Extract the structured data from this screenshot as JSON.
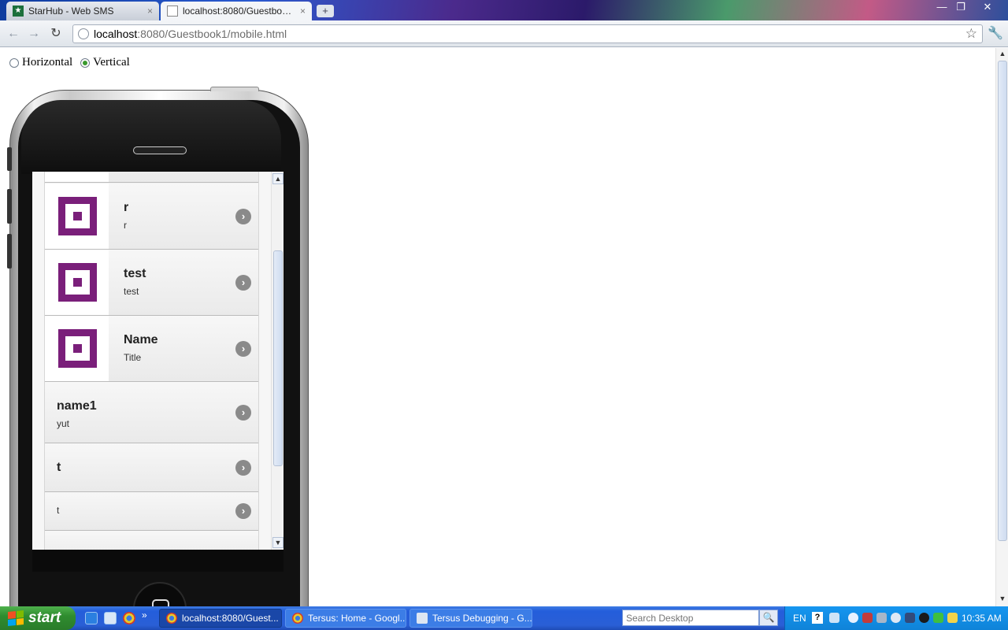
{
  "browser": {
    "tabs": [
      {
        "label": "StarHub - Web SMS",
        "active": false
      },
      {
        "label": "localhost:8080/Guestbook1...",
        "active": true
      }
    ],
    "new_tab_symbol": "+",
    "close_symbol": "×",
    "window_controls": {
      "minimize": "—",
      "restore": "❐",
      "close": "✕"
    },
    "toolbar": {
      "back_symbol": "←",
      "forward_symbol": "→",
      "reload_symbol": "↻",
      "url_host": "localhost",
      "url_rest": ":8080/Guestbook1/mobile.html",
      "star_symbol": "☆",
      "wrench_symbol": "🔧"
    }
  },
  "page": {
    "orientation": {
      "options": [
        {
          "label": "Horizontal",
          "selected": false
        },
        {
          "label": "Vertical",
          "selected": true
        }
      ]
    },
    "list_items": [
      {
        "title": "r",
        "subtitle": "r",
        "has_thumb": true
      },
      {
        "title": "test",
        "subtitle": "test",
        "has_thumb": true
      },
      {
        "title": "Name",
        "subtitle": "Title",
        "has_thumb": true
      },
      {
        "title": "name1",
        "subtitle": "yut",
        "has_thumb": false
      },
      {
        "title": "t",
        "subtitle": "",
        "has_thumb": false
      },
      {
        "title": "",
        "subtitle": "t",
        "has_thumb": false
      }
    ],
    "chevron_symbol": "›",
    "scroll_up_symbol": "▲",
    "scroll_down_symbol": "▼"
  },
  "taskbar": {
    "start_label": "start",
    "overflow_symbol": "»",
    "tasks": [
      {
        "label": "localhost:8080/Guest...",
        "active": true
      },
      {
        "label": "Tersus: Home - Googl...",
        "active": false
      },
      {
        "label": "Tersus Debugging - G...",
        "active": false
      }
    ],
    "search_placeholder": "Search Desktop",
    "search_symbol": "🔍",
    "language": "EN",
    "help_symbol": "?",
    "clock": "10:35 AM"
  },
  "colors": {
    "thumb_purple": "#7a1f7a",
    "taskbar_blue": "#245edb",
    "start_green": "#2f8c2f",
    "tray_blue": "#1696f0"
  }
}
